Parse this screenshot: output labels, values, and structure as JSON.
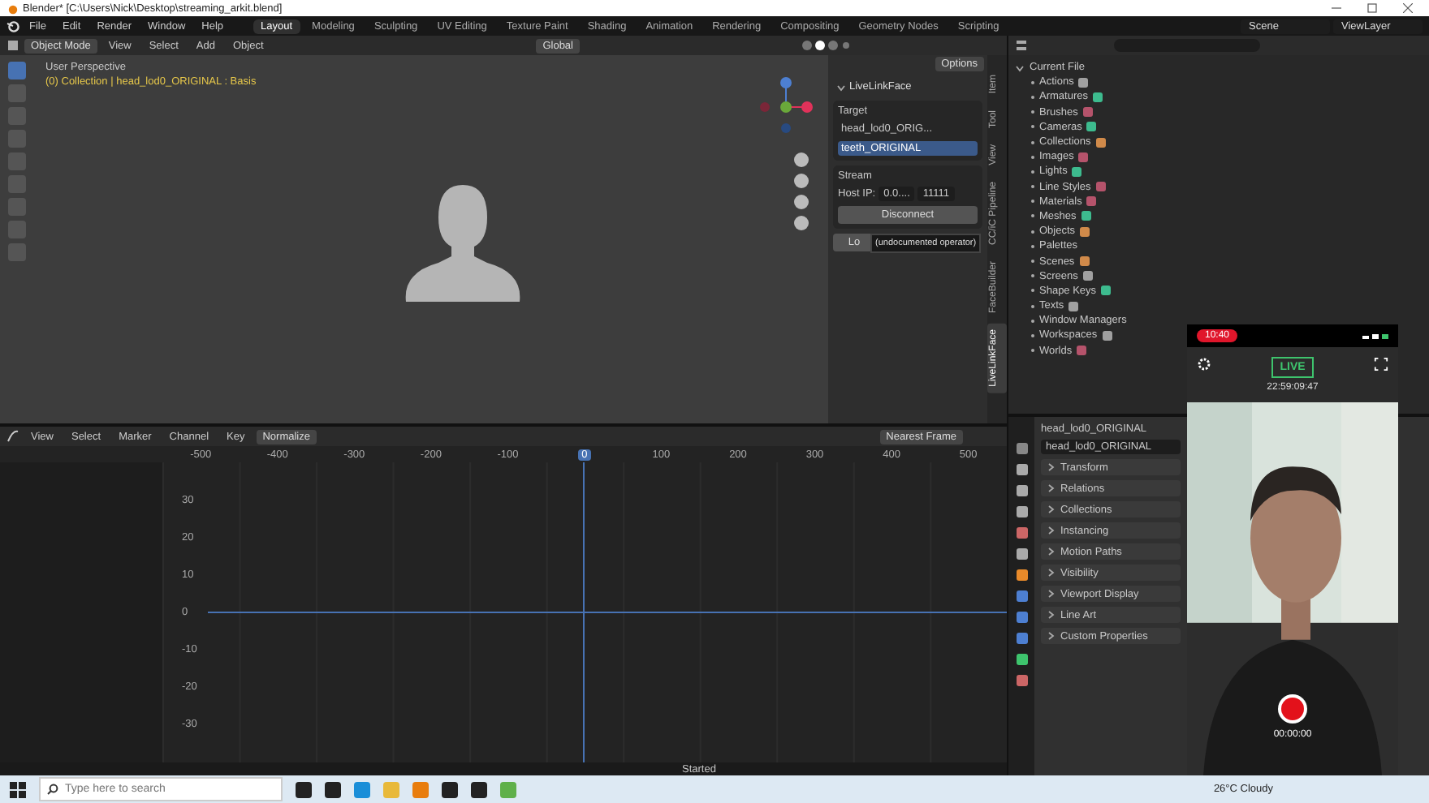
{
  "window": {
    "title": "Blender* [C:\\Users\\Nick\\Desktop\\streaming_arkit.blend]"
  },
  "menu": [
    "File",
    "Edit",
    "Render",
    "Window",
    "Help"
  ],
  "workspaces": [
    {
      "label": "Layout",
      "selected": true
    },
    {
      "label": "Modeling",
      "selected": false
    },
    {
      "label": "Sculpting",
      "selected": false
    },
    {
      "label": "UV Editing",
      "selected": false
    },
    {
      "label": "Texture Paint",
      "selected": false
    },
    {
      "label": "Shading",
      "selected": false
    },
    {
      "label": "Animation",
      "selected": false
    },
    {
      "label": "Rendering",
      "selected": false
    },
    {
      "label": "Compositing",
      "selected": false
    },
    {
      "label": "Geometry Nodes",
      "selected": false
    },
    {
      "label": "Scripting",
      "selected": false
    }
  ],
  "scene": "Scene",
  "view_layer": "ViewLayer",
  "viewport": {
    "mode": "Object Mode",
    "menus": [
      "View",
      "Select",
      "Add",
      "Object"
    ],
    "orientation": "Global",
    "options": "Options",
    "view_name": "User Perspective",
    "context": "(0) Collection | head_lod0_ORIGINAL : Basis",
    "sidebar": {
      "panel": "LiveLinkFace",
      "expanded": true,
      "target_label": "Target",
      "targets": [
        {
          "label": "head_lod0_ORIG...",
          "selected": false
        },
        {
          "label": "teeth_ORIGINAL",
          "selected": true
        }
      ],
      "stream_label": "Stream",
      "host_label": "Host IP:",
      "host_value": "0.0....",
      "port_value": "11111",
      "disconnect": "Disconnect",
      "load": "Lo",
      "tooltip": "(undocumented operator)",
      "tabs": [
        {
          "label": "Item",
          "selected": false
        },
        {
          "label": "Tool",
          "selected": false
        },
        {
          "label": "View",
          "selected": false
        },
        {
          "label": "CC/iC Pipeline",
          "selected": false
        },
        {
          "label": "FaceBuilder",
          "selected": false
        },
        {
          "label": "LiveLinkFace",
          "selected": true
        }
      ]
    }
  },
  "outliner": {
    "root": {
      "label": "Current File",
      "expanded": true,
      "children": [
        {
          "label": "Actions",
          "color": "#a0a0a0"
        },
        {
          "label": "Armatures",
          "color": "#3dbb8e"
        },
        {
          "label": "Brushes",
          "color": "#b5536b"
        },
        {
          "label": "Cameras",
          "color": "#3dbb8e"
        },
        {
          "label": "Collections",
          "color": "#d08a4a"
        },
        {
          "label": "Images",
          "color": "#b5536b"
        },
        {
          "label": "Lights",
          "color": "#3dbb8e"
        },
        {
          "label": "Line Styles",
          "color": "#b5536b"
        },
        {
          "label": "Materials",
          "color": "#b5536b"
        },
        {
          "label": "Meshes",
          "color": "#3dbb8e"
        },
        {
          "label": "Objects",
          "color": "#d08a4a"
        },
        {
          "label": "Palettes"
        },
        {
          "label": "Scenes",
          "color": "#d08a4a"
        },
        {
          "label": "Screens",
          "color": "#a0a0a0"
        },
        {
          "label": "Shape Keys",
          "color": "#3dbb8e"
        },
        {
          "label": "Texts",
          "color": "#a0a0a0"
        },
        {
          "label": "Window Managers"
        },
        {
          "label": "Workspaces",
          "color": "#a0a0a0"
        },
        {
          "label": "Worlds",
          "color": "#b5536b"
        }
      ]
    }
  },
  "graph_editor": {
    "menus": [
      "View",
      "Select",
      "Marker",
      "Channel",
      "Key"
    ],
    "normalize": "Normalize",
    "snap": "Nearest Frame",
    "frame_ticks": [
      {
        "label": "-500",
        "current": false
      },
      {
        "label": "-400",
        "current": false
      },
      {
        "label": "-300",
        "current": false
      },
      {
        "label": "-200",
        "current": false
      },
      {
        "label": "-100",
        "current": false
      },
      {
        "label": "0",
        "current": true
      },
      {
        "label": "100",
        "current": false
      },
      {
        "label": "200",
        "current": false
      },
      {
        "label": "300",
        "current": false
      },
      {
        "label": "400",
        "current": false
      },
      {
        "label": "500",
        "current": false
      }
    ],
    "value_ticks": [
      {
        "label": "30",
        "axis": false
      },
      {
        "label": "20",
        "axis": false
      },
      {
        "label": "10",
        "axis": false
      },
      {
        "label": "0",
        "axis": true
      },
      {
        "label": "-10",
        "axis": false
      },
      {
        "label": "-20",
        "axis": false
      },
      {
        "label": "-30",
        "axis": false
      }
    ],
    "status": "Started"
  },
  "properties": {
    "object": "head_lod0_ORIGINAL",
    "name_field": "head_lod0_ORIGINAL",
    "panels": [
      {
        "label": "Transform",
        "expanded": false
      },
      {
        "label": "Relations",
        "expanded": false
      },
      {
        "label": "Collections",
        "expanded": false
      },
      {
        "label": "Instancing",
        "expanded": false
      },
      {
        "label": "Motion Paths",
        "expanded": false
      },
      {
        "label": "Visibility",
        "expanded": false
      },
      {
        "label": "Viewport Display",
        "expanded": false
      },
      {
        "label": "Line Art",
        "expanded": false
      },
      {
        "label": "Custom Properties",
        "expanded": false
      }
    ]
  },
  "phone": {
    "clock": "10:40",
    "live": "LIVE",
    "timecode": "22:59:09:47",
    "record_time": "00:00:00"
  },
  "taskbar": {
    "search_placeholder": "Type here to search",
    "weather": "26°C Cloudy"
  }
}
